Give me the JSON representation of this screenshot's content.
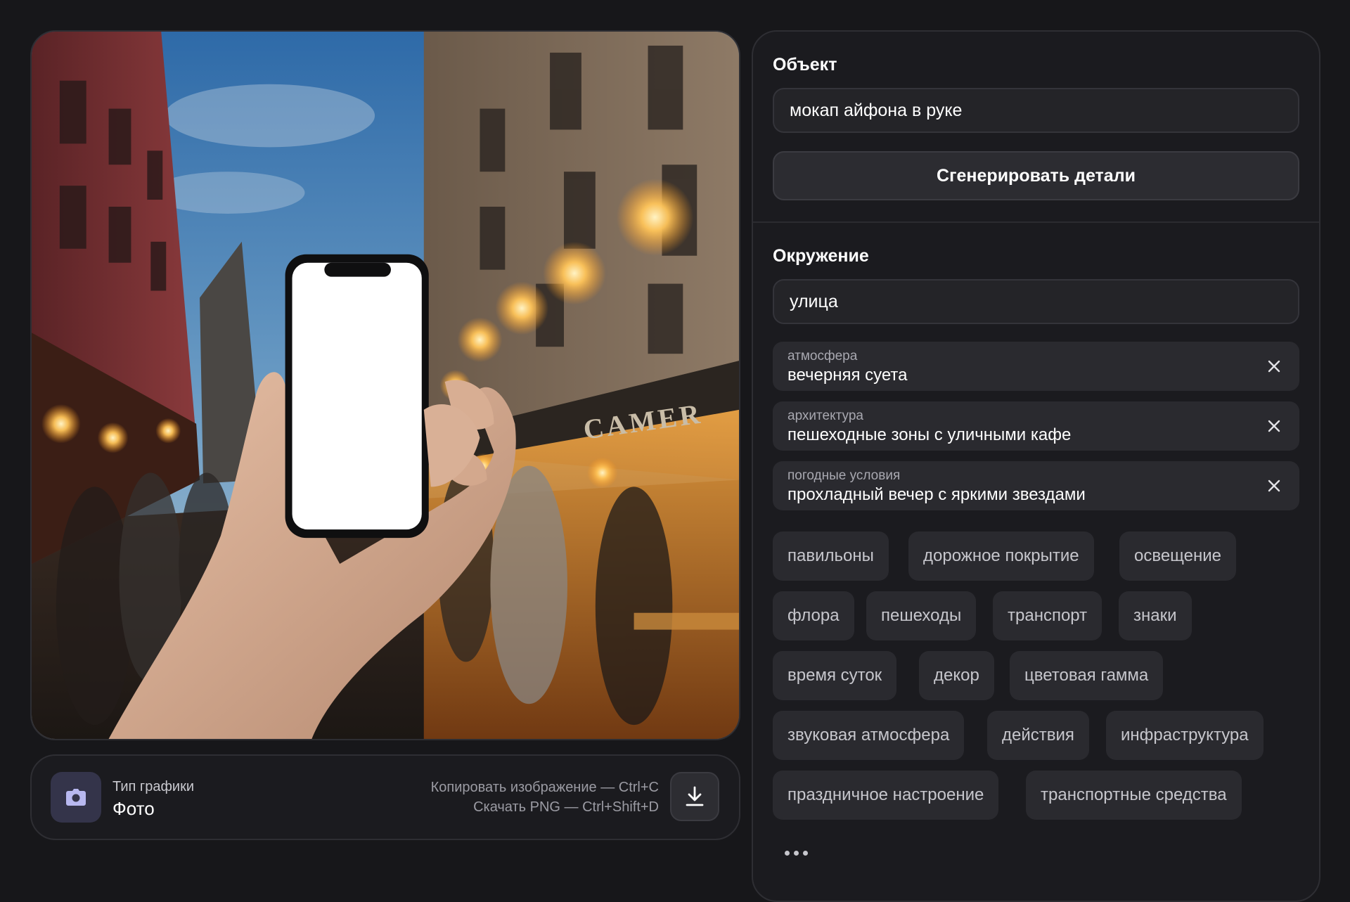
{
  "preview": {
    "alt": ""
  },
  "info_bar": {
    "type_caption": "Тип графики",
    "type_value": "Фото",
    "type_icon": "camera-icon",
    "hint_copy": "Копировать изображение — Ctrl+C",
    "hint_download": "Скачать PNG — Ctrl+Shift+D",
    "download_icon": "download-icon"
  },
  "object_section": {
    "title": "Объект",
    "value": "мокап айфона в руке",
    "generate_button": "Сгенерировать детали"
  },
  "environment_section": {
    "title": "Окружение",
    "value": "улица",
    "tags": [
      {
        "key": "атмосфера",
        "value": "вечерняя суета"
      },
      {
        "key": "архитектура",
        "value": "пешеходные зоны с уличными кафе"
      },
      {
        "key": "погодные условия",
        "value": "прохладный вечер с яркими звездами"
      }
    ],
    "chips": [
      "павильоны",
      "дорожное покрытие",
      "освещение",
      "флора",
      "пешеходы",
      "транспорт",
      "знаки",
      "время суток",
      "декор",
      "цветовая гамма",
      "звуковая атмосфера",
      "действия",
      "инфраструктура",
      "праздничное настроение",
      "транспортные средства"
    ]
  },
  "scene_sign": "CAMER",
  "colors": {
    "background": "#17171a",
    "panel": "#1b1b1f",
    "chip": "#2a2a2f",
    "accent_icon_bg": "#34344a"
  }
}
